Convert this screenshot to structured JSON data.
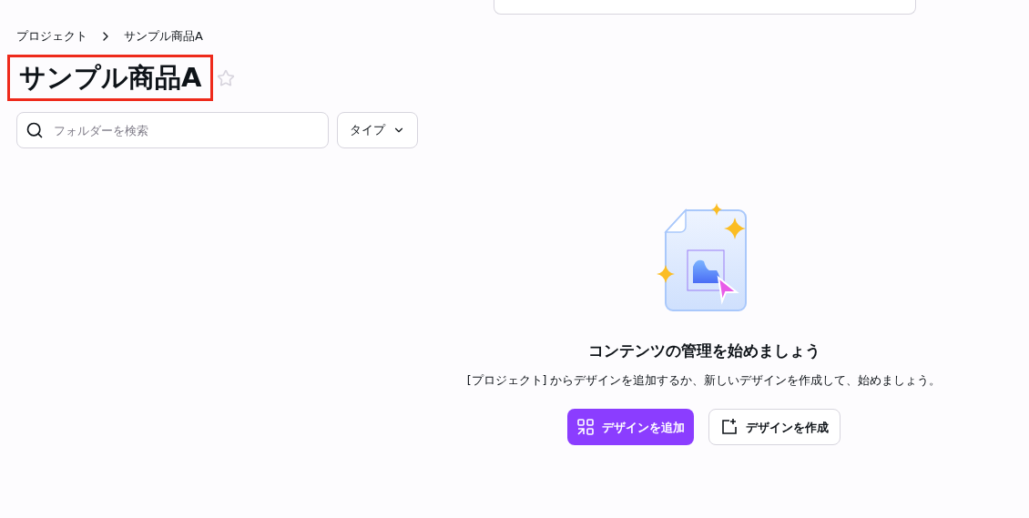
{
  "breadcrumb": [
    {
      "label": "プロジェクト"
    },
    {
      "label": "サンプル商品A"
    }
  ],
  "title": {
    "text": "サンプル商品A",
    "highlighted": true,
    "starred": false
  },
  "folder_search": {
    "placeholder": "フォルダーを検索"
  },
  "type_filter": {
    "label": "タイプ"
  },
  "empty_state": {
    "heading": "コンテンツの管理を始めましょう",
    "description": "[プロジェクト] からデザインを追加するか、新しいデザインを作成して、始めましょう。",
    "buttons": [
      {
        "kind": "primary",
        "label": "デザインを追加"
      },
      {
        "kind": "secondary",
        "label": "デザインを作成"
      }
    ]
  }
}
